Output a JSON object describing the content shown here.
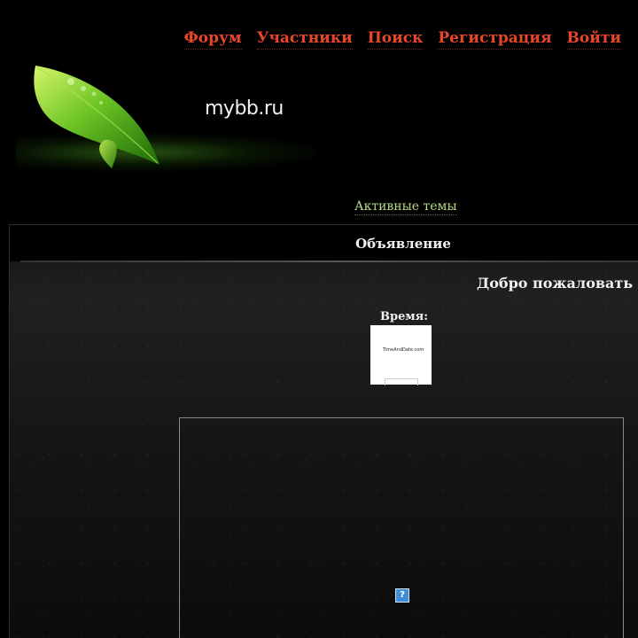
{
  "nav": {
    "items": [
      {
        "label": "Форум"
      },
      {
        "label": "Участники"
      },
      {
        "label": "Поиск"
      },
      {
        "label": "Регистрация"
      },
      {
        "label": "Войти"
      }
    ]
  },
  "header": {
    "brand": "mybb.ru"
  },
  "active_topics": "Активные темы",
  "announcement": {
    "title": "Объявление",
    "welcome": "Добро пожаловать на",
    "time_label": "Время:",
    "clock_logo": "TimeAndDate.com",
    "broken_image_glyph": "?"
  },
  "colors": {
    "nav_link": "#e8462a",
    "active_topics_link": "#b8d88a",
    "background": "#000000"
  },
  "icons": {
    "logo": "green-leaf-icon",
    "missing_image": "broken-image-icon"
  }
}
